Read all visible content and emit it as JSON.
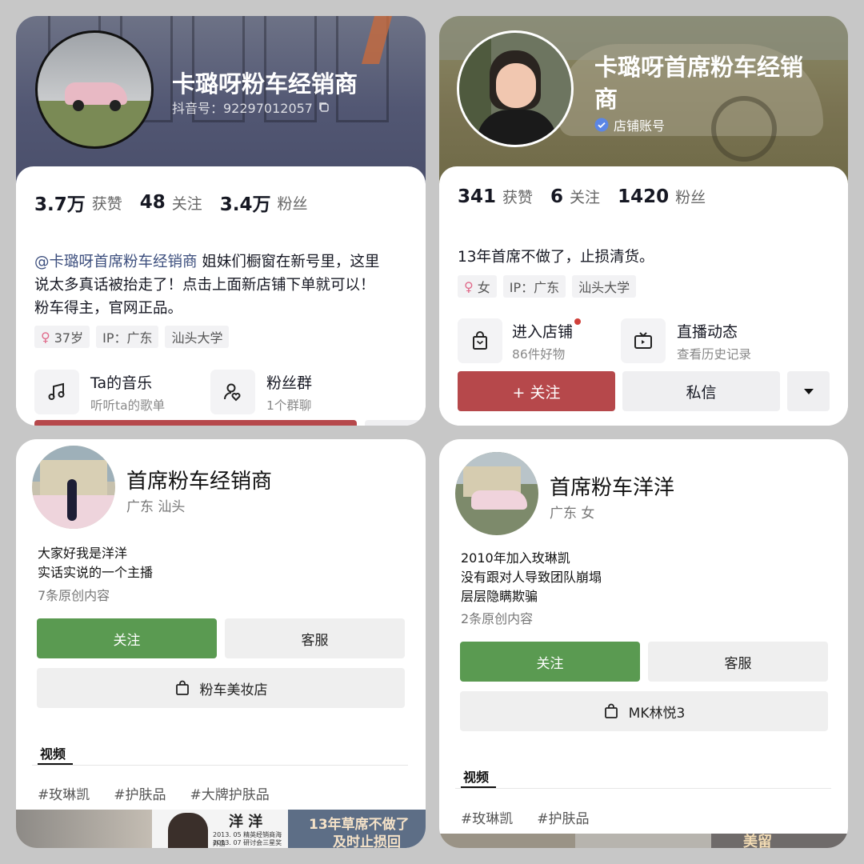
{
  "card1": {
    "name": "卡璐呀粉车经销商",
    "douyin_id": "抖音号：92297012057",
    "stats": [
      {
        "num": "3.7万",
        "label": "获赞"
      },
      {
        "num": "48",
        "label": "关注"
      },
      {
        "num": "3.4万",
        "label": "粉丝"
      }
    ],
    "bio_mention": "@卡璐呀首席粉车经销商",
    "bio_line1_rest": " 姐妹们橱窗在新号里，这里",
    "bio_line2": "说太多真话被抬走了！点击上面新店铺下单就可以！",
    "bio_line3": "粉车得主，官网正品。",
    "tags": [
      "37岁",
      "IP：广东",
      "汕头大学"
    ],
    "features": [
      {
        "title": "Ta的音乐",
        "sub": "听听ta的歌单",
        "icon": "music-note-icon"
      },
      {
        "title": "粉丝群",
        "sub": "1个群聊",
        "icon": "fan-group-icon"
      }
    ],
    "accent": "#b6484b"
  },
  "card2": {
    "name_line1": "卡璐呀首席粉车经销",
    "name_line2": "商",
    "badge": "店铺账号",
    "stats": [
      {
        "num": "341",
        "label": "获赞"
      },
      {
        "num": "6",
        "label": "关注"
      },
      {
        "num": "1420",
        "label": "粉丝"
      }
    ],
    "bio": "13年首席不做了，止损清货。",
    "tags": [
      "女",
      "IP：广东",
      "汕头大学"
    ],
    "features": [
      {
        "title": "进入店铺",
        "sub": "86件好物",
        "icon": "shopping-bag-icon"
      },
      {
        "title": "直播动态",
        "sub": "查看历史记录",
        "icon": "live-tv-icon"
      }
    ],
    "follow": "+ 关注",
    "message": "私信",
    "more_icon": "caret-down-icon",
    "accent": "#b6484b"
  },
  "card3": {
    "name": "首席粉车经销商",
    "location": "广东 汕头",
    "bio": [
      "大家好我是洋洋",
      "实话实说的一个主播"
    ],
    "count": "7条原创内容",
    "follow": "关注",
    "service": "客服",
    "shop": "粉车美妆店",
    "tab": "视频",
    "hashtags": [
      "#玫琳凯",
      "#护肤品",
      "#大牌护肤品"
    ],
    "thumb_text1": "洋 洋",
    "thumb_small1": "2013. 05  精英经销商海外游",
    "thumb_small2": "2013. 07  研讨会三星奖",
    "thumb_text2a": "13年草席不做了",
    "thumb_text2b": "及时止损回"
  },
  "card4": {
    "name": "首席粉车洋洋",
    "location": "广东 女",
    "bio": [
      "2010年加入玫琳凯",
      "没有跟对人导致团队崩塌",
      "层层隐瞒欺骗"
    ],
    "count": "2条原创内容",
    "follow": "关注",
    "service": "客服",
    "shop": "MK林悦3",
    "tab": "视频",
    "hashtags": [
      "#玫琳凯",
      "#护肤品"
    ],
    "thumb_text": "美留"
  }
}
